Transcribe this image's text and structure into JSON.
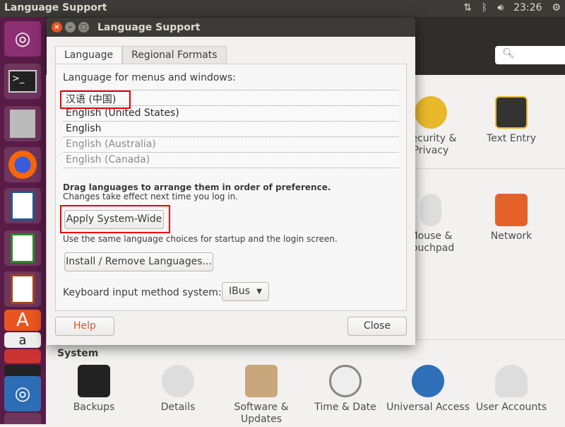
{
  "topbar": {
    "title": "Language Support",
    "time": "23:26",
    "icons": [
      "network-arrows-icon",
      "bluetooth-icon",
      "volume-icon",
      "power-gear-icon"
    ]
  },
  "launcher": {
    "items": [
      "ubuntu-dash",
      "terminal",
      "files-cabinet",
      "firefox",
      "libreoffice-writer",
      "libreoffice-calc",
      "libreoffice-impress",
      "ubuntu-software",
      "amazon",
      "system-settings-tools",
      "system-settings",
      "trash"
    ]
  },
  "settings": {
    "search_icon": "search-icon",
    "items": [
      {
        "label": "Security & Privacy"
      },
      {
        "label": "Text Entry"
      },
      {
        "label": "Mouse & Touchpad"
      },
      {
        "label": "Network"
      }
    ],
    "system": {
      "title": "System",
      "items": [
        "Backups",
        "Details",
        "Software & Updates",
        "Time & Date",
        "Universal Access",
        "User Accounts"
      ]
    }
  },
  "dialog": {
    "title": "Language Support",
    "tabs": [
      "Language",
      "Regional Formats"
    ],
    "list_label": "Language for menus and windows:",
    "languages": [
      {
        "name": "汉语 (中国)",
        "dim": false
      },
      {
        "name": "English (United States)",
        "dim": false
      },
      {
        "name": "English",
        "dim": false
      },
      {
        "name": "English (Australia)",
        "dim": true
      },
      {
        "name": "English (Canada)",
        "dim": true
      }
    ],
    "drag_hint": "Drag languages to arrange them in order of preference.",
    "changes_hint": "Changes take effect next time you log in.",
    "apply_button": "Apply System-Wide",
    "apply_hint": "Use the same language choices for startup and the login screen.",
    "install_button": "Install / Remove Languages...",
    "input_label": "Keyboard input method system:",
    "input_value": "IBus",
    "help_button": "Help",
    "close_button": "Close"
  },
  "colors": {
    "highlight": "#e00000",
    "help_text": "#e0541f"
  }
}
